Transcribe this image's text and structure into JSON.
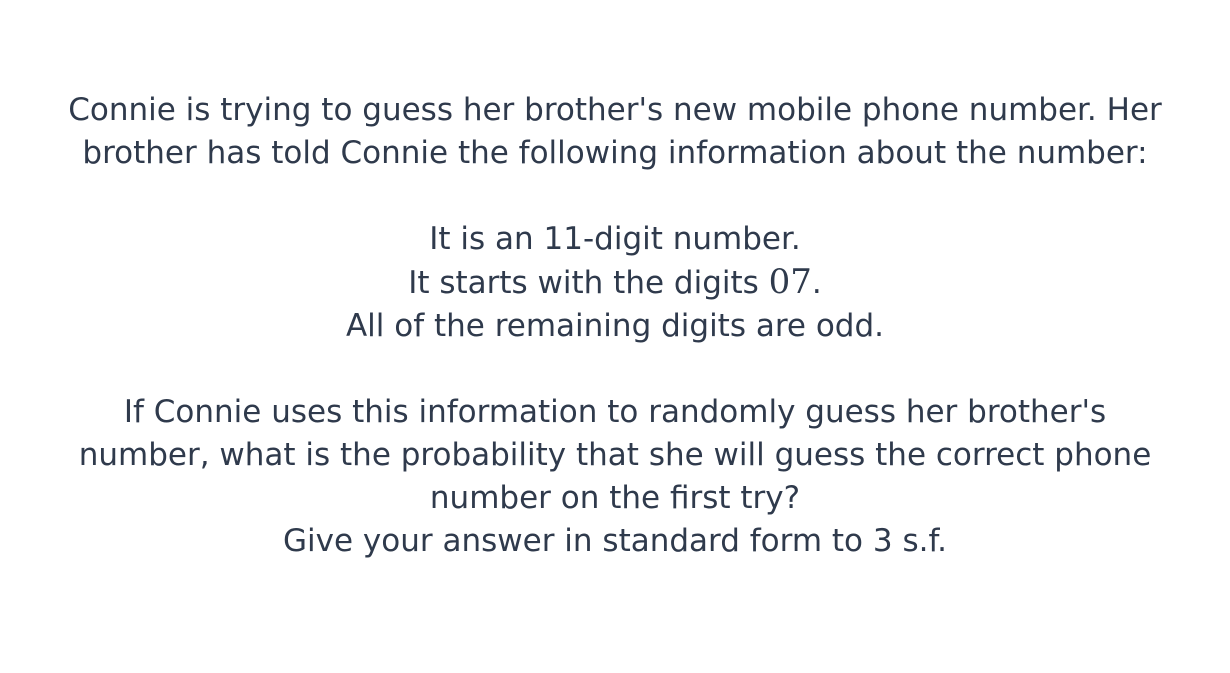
{
  "question": {
    "intro": {
      "line1": "Connie is trying to guess her brother's new mobile phone number. Her",
      "line2": "brother has told Connie the following information about the number:"
    },
    "facts": {
      "fact1": "It is an 11-digit number.",
      "fact2_prefix": "It starts with the digits ",
      "fact2_math": "07",
      "fact2_suffix": ".",
      "fact3": "All of the remaining digits are odd."
    },
    "prompt": {
      "line1": "If Connie uses this information to randomly guess her brother's",
      "line2": "number, what is the probability that she will guess the correct phone",
      "line3": "number on the first try?",
      "line4": "Give your answer in standard form to 3 s.f."
    }
  }
}
